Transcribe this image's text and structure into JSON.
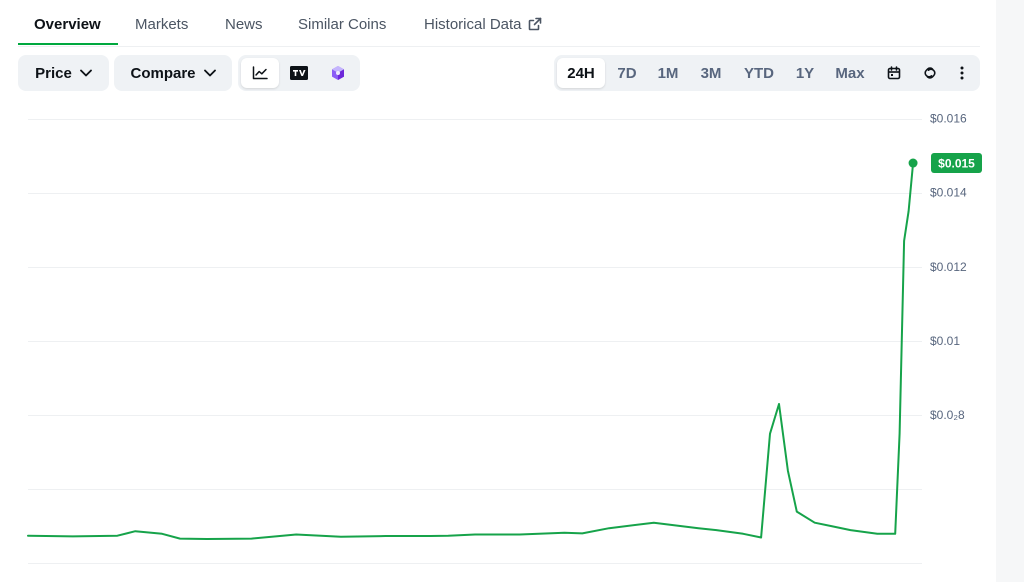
{
  "tabs": [
    {
      "label": "Overview",
      "active": true
    },
    {
      "label": "Markets",
      "active": false
    },
    {
      "label": "News",
      "active": false
    },
    {
      "label": "Similar Coins",
      "active": false
    },
    {
      "label": "Historical Data",
      "active": false,
      "external": true
    }
  ],
  "toolbar": {
    "price_label": "Price",
    "compare_label": "Compare",
    "chart_modes": [
      {
        "icon": "line-chart-icon",
        "active": true
      },
      {
        "icon": "tradingview-icon",
        "active": false
      },
      {
        "icon": "cube-icon",
        "active": false
      }
    ],
    "ranges": [
      {
        "label": "24H",
        "active": true
      },
      {
        "label": "7D",
        "active": false
      },
      {
        "label": "1M",
        "active": false
      },
      {
        "label": "3M",
        "active": false
      },
      {
        "label": "YTD",
        "active": false
      },
      {
        "label": "1Y",
        "active": false
      },
      {
        "label": "Max",
        "active": false
      }
    ],
    "extra_icons": [
      "calendar-icon",
      "link-icon",
      "more-vertical-icon"
    ]
  },
  "colors": {
    "accent": "#00a83e",
    "line": "#16a34a",
    "text": "#0d1217",
    "muted": "#58667e",
    "button_bg": "#eff2f5",
    "grid": "#eef0f2"
  },
  "chart_data": {
    "type": "line",
    "ylim": [
      0.0035,
      0.0165
    ],
    "yticks": [
      {
        "value": 0.016,
        "label": "$0.016"
      },
      {
        "value": 0.014,
        "label": "$0.014"
      },
      {
        "value": 0.012,
        "label": "$0.012"
      },
      {
        "value": 0.01,
        "label": "$0.01"
      },
      {
        "value": 0.008,
        "label": "$0.0₂8"
      }
    ],
    "x": [
      0,
      5,
      10,
      12,
      15,
      17,
      20,
      25,
      30,
      35,
      40,
      45,
      47,
      50,
      55,
      60,
      62,
      65,
      70,
      75,
      77,
      80,
      82,
      83,
      84,
      85,
      86,
      88,
      90,
      92,
      95,
      97,
      97.5,
      98,
      98.5,
      99
    ],
    "values": [
      0.00475,
      0.00473,
      0.00475,
      0.00487,
      0.0048,
      0.00467,
      0.00466,
      0.00467,
      0.00478,
      0.00472,
      0.00474,
      0.00474,
      0.00475,
      0.00478,
      0.00478,
      0.00483,
      0.00481,
      0.00495,
      0.0051,
      0.00495,
      0.0049,
      0.0048,
      0.0047,
      0.0075,
      0.0083,
      0.0065,
      0.0054,
      0.0051,
      0.005,
      0.0049,
      0.0048,
      0.0048,
      0.0075,
      0.0127,
      0.0135,
      0.0148
    ],
    "last_value_label": "$0.015"
  }
}
